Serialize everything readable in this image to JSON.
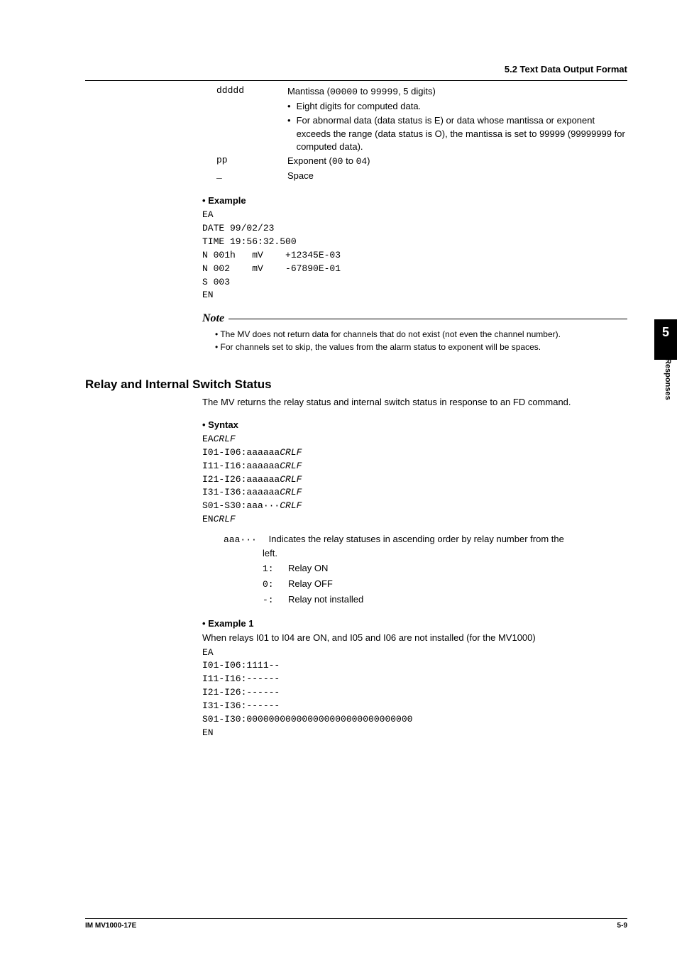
{
  "header": {
    "section": "5.2  Text Data Output Format"
  },
  "defs": {
    "ddddd_term": "ddddd",
    "ddddd_desc": "Mantissa (",
    "ddddd_range": "00000",
    "ddddd_to": " to ",
    "ddddd_end": "99999",
    "ddddd_tail": ", 5 digits)",
    "ddddd_b1": "Eight digits for computed data.",
    "ddddd_b2": "For abnormal data (data status is E) or data whose mantissa or exponent exceeds the range (data status is O), the mantissa is set to 99999 (99999999 for computed data).",
    "pp_term": "pp",
    "pp_desc_a": "Exponent (",
    "pp_r1": "00",
    "pp_to": " to ",
    "pp_r2": "04",
    "pp_desc_b": ")",
    "sp_term": "_",
    "sp_desc": "Space"
  },
  "example": {
    "title": "Example",
    "code": "EA\nDATE 99/02/23\nTIME 19:56:32.500\nN 001h   mV    +12345E-03\nN 002    mV    -67890E-01\nS 003\nEN"
  },
  "note": {
    "title": "Note",
    "n1": "The MV does not return data for channels that do not exist (not even the channel number).",
    "n2": "For channels set to skip, the values from the alarm status to exponent will be spaces."
  },
  "relay": {
    "heading": "Relay and Internal Switch Status",
    "intro": "The MV returns the relay status and internal switch status in response to an FD command.",
    "syntax_title": "Syntax",
    "syntax_lines": [
      {
        "p": "EA",
        "s": "CRLF"
      },
      {
        "p": "I01-I06:aaaaaa",
        "s": "CRLF"
      },
      {
        "p": "I11-I16:aaaaaa",
        "s": "CRLF"
      },
      {
        "p": "I21-I26:aaaaaa",
        "s": "CRLF"
      },
      {
        "p": "I31-I36:aaaaaa",
        "s": "CRLF"
      },
      {
        "p": "S01-S30:aaa···",
        "s": "CRLF"
      },
      {
        "p": "EN",
        "s": "CRLF"
      }
    ],
    "aaa_term": "aaa···",
    "aaa_desc": "Indicates the relay statuses in ascending order by relay number from the",
    "aaa_desc2": "left.",
    "s1k": "1:",
    "s1v": "Relay ON",
    "s2k": "0:",
    "s2v": "Relay OFF",
    "s3k": "-:",
    "s3v": "Relay not installed",
    "ex1_title": "Example 1",
    "ex1_intro": "When relays I01 to I04 are ON, and I05 and I06 are not installed (for the MV1000)",
    "ex1_code": "EA\nI01-I06:1111--\nI11-I16:------\nI21-I26:------\nI31-I36:------\nS01-I30:000000000000000000000000000000\nEN"
  },
  "sidetab": {
    "num": "5",
    "label": "Responses"
  },
  "footer": {
    "left": "IM MV1000-17E",
    "right": "5-9"
  }
}
